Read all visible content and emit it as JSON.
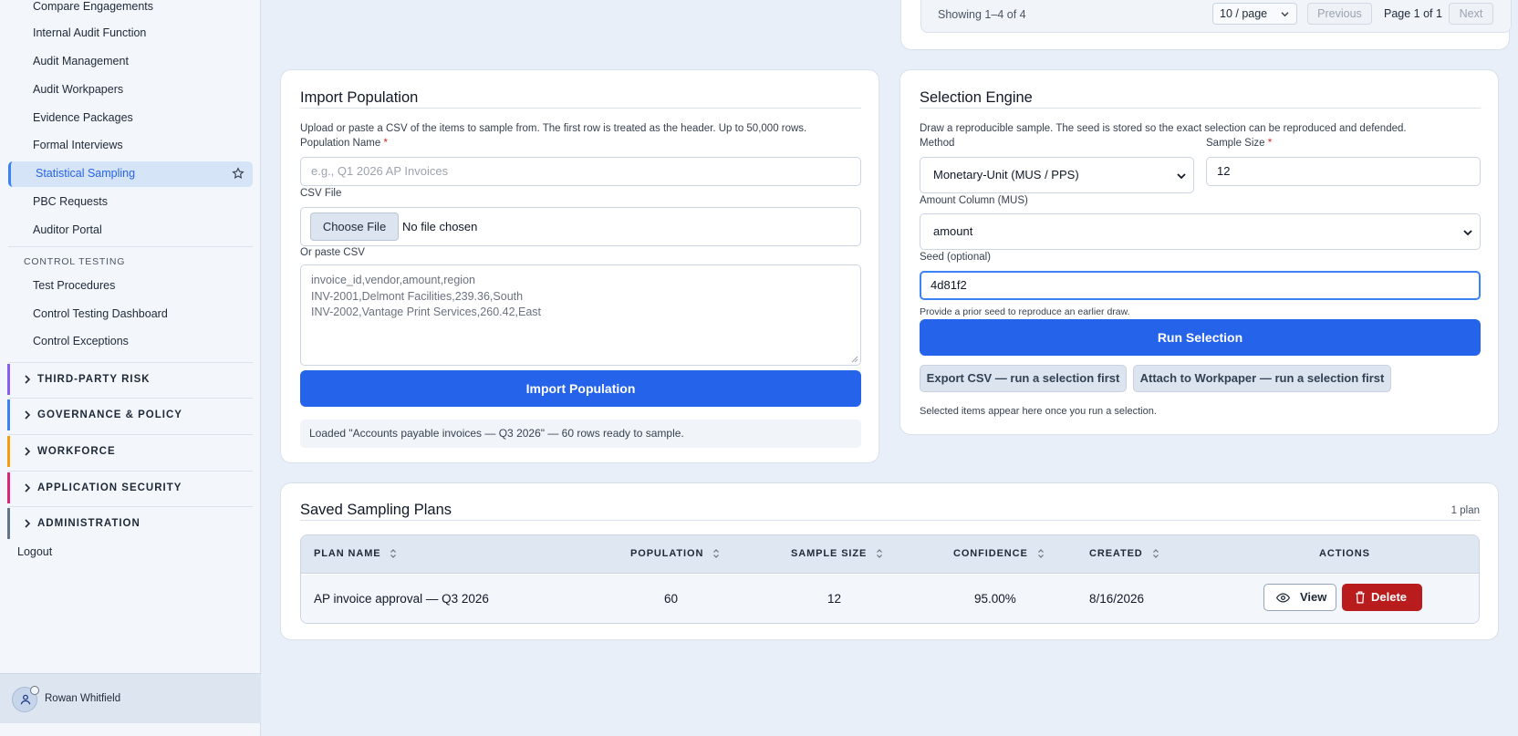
{
  "sidebar": {
    "items": [
      {
        "label": "Compare Engagements",
        "name": "sidebar-item-compare-engagements"
      },
      {
        "label": "Internal Audit Function",
        "name": "sidebar-item-internal-audit-function"
      },
      {
        "label": "Audit Management",
        "name": "sidebar-item-audit-management"
      },
      {
        "label": "Audit Workpapers",
        "name": "sidebar-item-audit-workpapers"
      },
      {
        "label": "Evidence Packages",
        "name": "sidebar-item-evidence-packages"
      },
      {
        "label": "Formal Interviews",
        "name": "sidebar-item-formal-interviews"
      }
    ],
    "active_item": "Statistical Sampling",
    "items_after": [
      {
        "label": "PBC Requests",
        "name": "sidebar-item-pbc-requests"
      },
      {
        "label": "Auditor Portal",
        "name": "sidebar-item-auditor-portal"
      }
    ],
    "section_heading": "CONTROL TESTING",
    "section_items": [
      {
        "label": "Test Procedures",
        "name": "sidebar-item-test-procedures"
      },
      {
        "label": "Control Testing Dashboard",
        "name": "sidebar-item-control-testing-dashboard"
      },
      {
        "label": "Control Exceptions",
        "name": "sidebar-item-control-exceptions"
      }
    ],
    "groups": [
      {
        "label": "THIRD-PARTY RISK",
        "color": "#8b5cf6"
      },
      {
        "label": "GOVERNANCE & POLICY",
        "color": "#3b82f6"
      },
      {
        "label": "WORKFORCE",
        "color": "#f59e0b"
      },
      {
        "label": "APPLICATION SECURITY",
        "color": "#db2777"
      },
      {
        "label": "ADMINISTRATION",
        "color": "#64748b"
      }
    ],
    "logout": "Logout",
    "user_name": "Rowan Whitfield"
  },
  "pagination": {
    "showing": "Showing 1–4 of 4",
    "page_size": "10 / page",
    "previous": "Previous",
    "page_info": "Page 1 of 1",
    "next": "Next"
  },
  "import_population": {
    "title": "Import Population",
    "description": "Upload or paste a CSV of the items to sample from. The first row is treated as the header. Up to 50,000 rows.",
    "name_label": "Population Name",
    "required_mark": "*",
    "name_placeholder": "e.g., Q1 2026 AP Invoices",
    "csv_file_label": "CSV File",
    "choose_file": "Choose File",
    "no_file": "No file chosen",
    "paste_label": "Or paste CSV",
    "paste_lines": [
      "invoice_id,vendor,amount,region",
      "INV-2001,Delmont Facilities,239.36,South",
      "INV-2002,Vantage Print Services,260.42,East"
    ],
    "import_button": "Import Population",
    "status": "Loaded \"Accounts payable invoices — Q3 2026\" — 60 rows ready to sample."
  },
  "selection_engine": {
    "title": "Selection Engine",
    "description": "Draw a reproducible sample. The seed is stored so the exact selection can be reproduced and defended.",
    "method_label": "Method",
    "method_value": "Monetary-Unit (MUS / PPS)",
    "sample_size_label": "Sample Size",
    "required_mark": "*",
    "sample_size_value": "12",
    "amount_column_label": "Amount Column (MUS)",
    "amount_column_value": "amount",
    "seed_label": "Seed (optional)",
    "seed_value": "4d81f2",
    "seed_hint": "Provide a prior seed to reproduce an earlier draw.",
    "run_button": "Run Selection",
    "export_button": "Export CSV — run a selection first",
    "attach_button": "Attach to Workpaper — run a selection first",
    "note": "Selected items appear here once you run a selection."
  },
  "saved_plans": {
    "title": "Saved Sampling Plans",
    "count": "1 plan",
    "columns": [
      "PLAN NAME",
      "POPULATION",
      "SAMPLE SIZE",
      "CONFIDENCE",
      "CREATED",
      "ACTIONS"
    ],
    "rows": [
      {
        "plan_name": "AP invoice approval — Q3 2026",
        "population": "60",
        "sample_size": "12",
        "confidence": "95.00%",
        "created": "8/16/2026"
      }
    ],
    "view_button": "View",
    "delete_button": "Delete"
  },
  "colors": {
    "primary": "#2563eb",
    "danger": "#b91c1c",
    "active_bg": "#d6e4f7"
  }
}
